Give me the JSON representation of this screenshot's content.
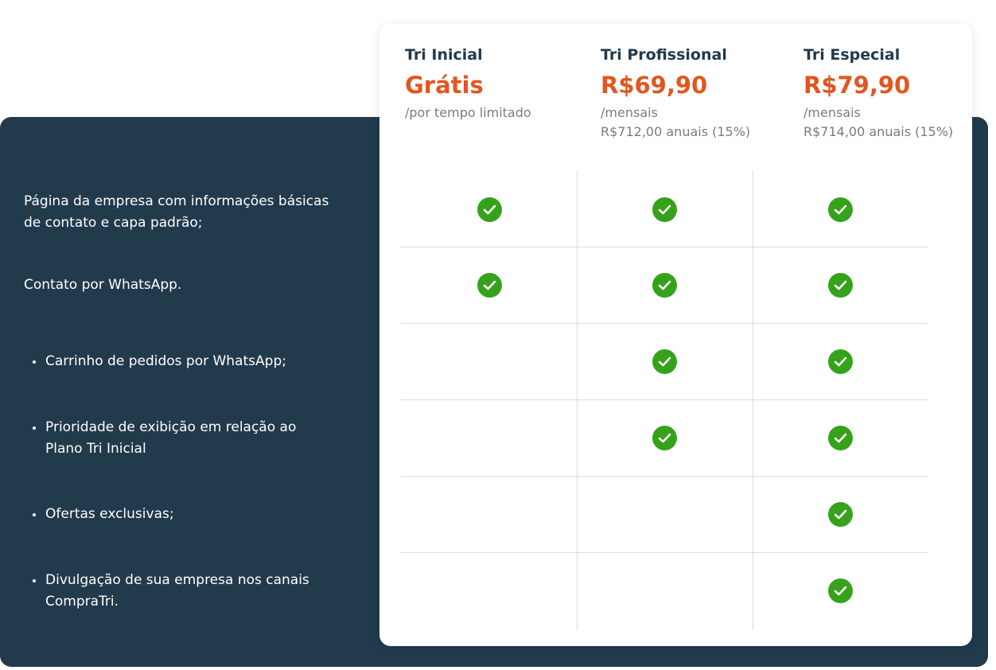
{
  "features": [
    {
      "text": "Página da empresa com informações básicas de contato e capa padrão;",
      "bullet": false
    },
    {
      "text": "Contato por WhatsApp.",
      "bullet": false
    },
    {
      "text": "Carrinho de pedidos por WhatsApp;",
      "bullet": true
    },
    {
      "text": "Prioridade de exibição em relação ao Plano Tri Inicial",
      "bullet": true
    },
    {
      "text": "Ofertas exclusivas;",
      "bullet": true
    },
    {
      "text": "Divulgação de sua empresa nos canais CompraTri.",
      "bullet": true
    }
  ],
  "plans": [
    {
      "name": "Tri Inicial",
      "price": "Grátis",
      "period": "/por tempo limitado",
      "annual": ""
    },
    {
      "name": "Tri Profissional",
      "price": "R$69,90",
      "period": "/mensais",
      "annual": "R$712,00 anuais (15%)"
    },
    {
      "name": "Tri Especial",
      "price": "R$79,90",
      "period": "/mensais",
      "annual": "R$714,00 anuais (15%)"
    }
  ],
  "availability": [
    [
      true,
      true,
      true
    ],
    [
      true,
      true,
      true
    ],
    [
      false,
      true,
      true
    ],
    [
      false,
      true,
      true
    ],
    [
      false,
      false,
      true
    ],
    [
      false,
      false,
      true
    ]
  ],
  "colors": {
    "panel_bg": "#213a4c",
    "price": "#e2561f",
    "check": "#36a21b",
    "plan_name": "#213a4c"
  },
  "icons": {
    "included": "check-circle-icon"
  }
}
